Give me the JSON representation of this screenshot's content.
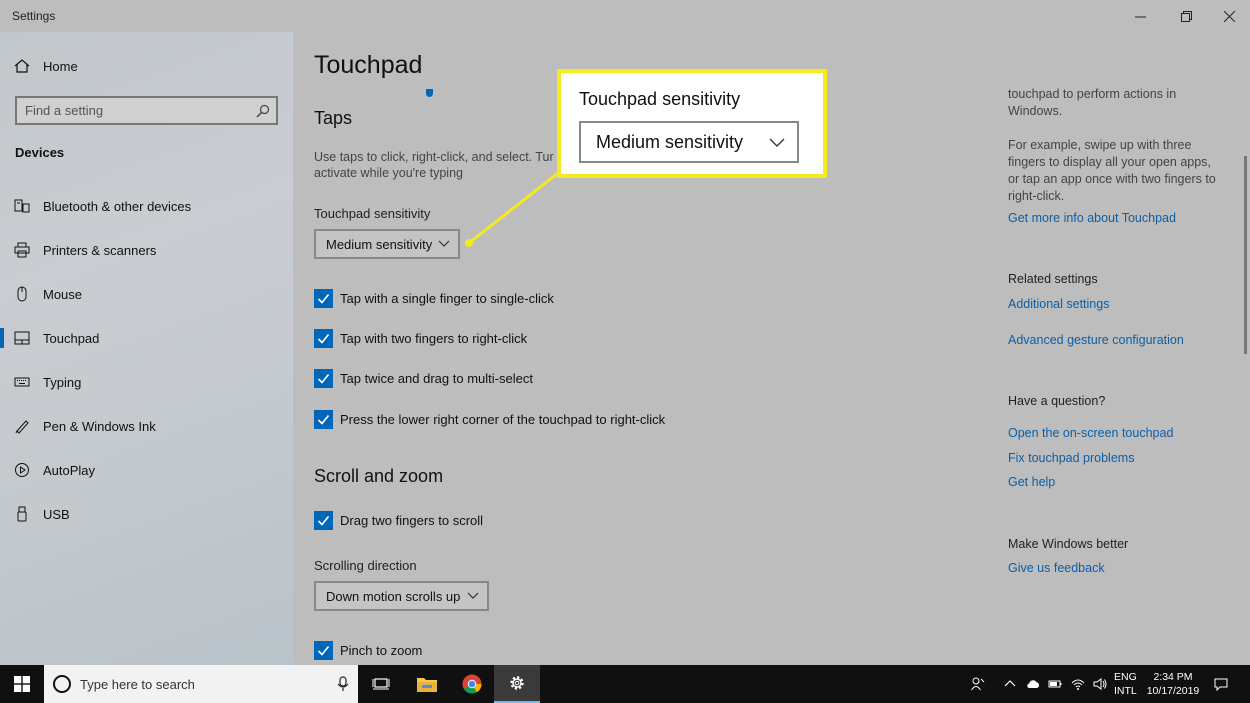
{
  "window": {
    "title": "Settings"
  },
  "sidebar": {
    "home": "Home",
    "search_placeholder": "Find a setting",
    "section": "Devices",
    "items": [
      {
        "label": "Bluetooth & other devices",
        "icon": "bluetooth-devices-icon"
      },
      {
        "label": "Printers & scanners",
        "icon": "printer-icon"
      },
      {
        "label": "Mouse",
        "icon": "mouse-icon"
      },
      {
        "label": "Touchpad",
        "icon": "touchpad-icon",
        "active": true
      },
      {
        "label": "Typing",
        "icon": "keyboard-icon"
      },
      {
        "label": "Pen & Windows Ink",
        "icon": "pen-icon"
      },
      {
        "label": "AutoPlay",
        "icon": "autoplay-icon"
      },
      {
        "label": "USB",
        "icon": "usb-icon"
      }
    ]
  },
  "main": {
    "title": "Touchpad",
    "taps": {
      "heading": "Taps",
      "description_line1": "Use taps to click, right-click, and select. Tur",
      "description_line2": "activate while you're typing",
      "sensitivity_label": "Touchpad sensitivity",
      "sensitivity_value": "Medium sensitivity",
      "checkboxes": [
        {
          "label": "Tap with a single finger to single-click",
          "checked": true
        },
        {
          "label": "Tap with two fingers to right-click",
          "checked": true
        },
        {
          "label": "Tap twice and drag to multi-select",
          "checked": true
        },
        {
          "label": "Press the lower right corner of the touchpad to right-click",
          "checked": true
        }
      ]
    },
    "scroll_zoom": {
      "heading": "Scroll and zoom",
      "drag_two_fingers": "Drag two fingers to scroll",
      "direction_label": "Scrolling direction",
      "direction_value": "Down motion scrolls up",
      "pinch": "Pinch to zoom"
    }
  },
  "right": {
    "intro_line1": "touchpad to perform actions in",
    "intro_line2": "Windows.",
    "example_line1": "For example, swipe up with three",
    "example_line2": "fingers to display all your open apps,",
    "example_line3": "or tap an app once with two fingers to",
    "example_line4": "right-click.",
    "more_info": "Get more info about Touchpad",
    "related_heading": "Related settings",
    "additional_settings": "Additional settings",
    "advanced_gesture": "Advanced gesture configuration",
    "question_heading": "Have a question?",
    "onscreen_touchpad": "Open the on-screen touchpad",
    "fix_problems": "Fix touchpad problems",
    "get_help": "Get help",
    "better_heading": "Make Windows better",
    "feedback": "Give us feedback"
  },
  "callout": {
    "label": "Touchpad sensitivity",
    "value": "Medium sensitivity",
    "border_color": "#f5ea1e"
  },
  "taskbar": {
    "search_text": "Type here to search",
    "lang_line1": "ENG",
    "lang_line2": "INTL",
    "time": "2:34 PM",
    "date": "10/17/2019"
  },
  "colors": {
    "accent": "#0067b8",
    "link": "#0b5fa8",
    "highlight": "#f5ea1e"
  }
}
